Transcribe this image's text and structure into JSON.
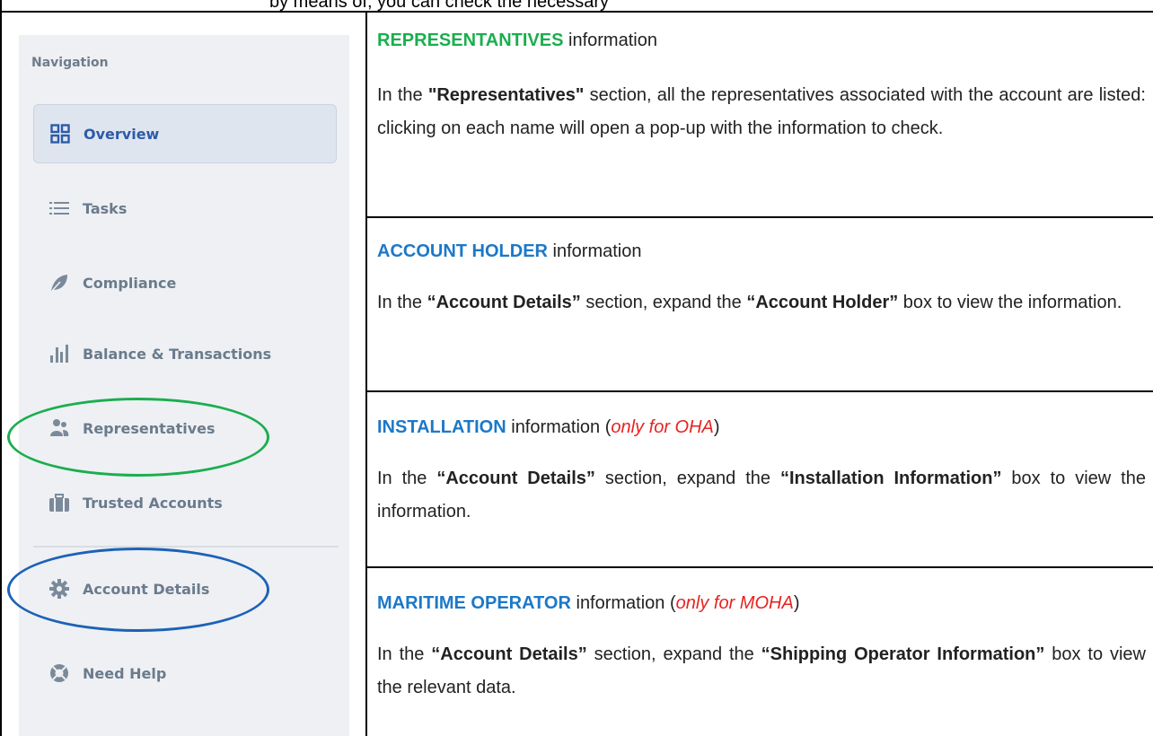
{
  "top_clip_text": "by means of, you can check the necessary",
  "sidebar": {
    "heading": "Navigation",
    "items": [
      {
        "label": "Overview",
        "icon": "grid-icon"
      },
      {
        "label": "Tasks",
        "icon": "list-icon"
      },
      {
        "label": "Compliance",
        "icon": "leaf-icon"
      },
      {
        "label": "Balance & Transactions",
        "icon": "bar-chart-icon"
      },
      {
        "label": "Representatives",
        "icon": "users-icon"
      },
      {
        "label": "Trusted Accounts",
        "icon": "briefcase-icon"
      },
      {
        "label": "Account Details",
        "icon": "gear-icon"
      },
      {
        "label": "Need Help",
        "icon": "lifebuoy-icon"
      }
    ]
  },
  "sections": [
    {
      "keyword": "REPRESENTANTIVES",
      "title_rest": " information",
      "body_pre": "In the ",
      "body_b1": "\"Representatives\"",
      "body_mid": " section, all the representatives associated with the account are listed: clicking on each name will open a pop-up with the information to check."
    },
    {
      "keyword": "ACCOUNT HOLDER",
      "title_rest": " information",
      "body_pre": "In the ",
      "body_b1": "“Account Details”",
      "body_mid": " section, expand the ",
      "body_b2": "“Account Holder”",
      "body_end": " box to view the information."
    },
    {
      "keyword": "INSTALLATION",
      "title_rest": " information (",
      "qualifier": "only for OHA",
      "title_close": ")",
      "body_pre": "In the ",
      "body_b1": "“Account Details”",
      "body_mid": " section, expand the ",
      "body_b2": "“Installation Information”",
      "body_end": " box to view the information."
    },
    {
      "keyword": "MARITIME OPERATOR",
      "title_rest": " information (",
      "qualifier": "only for MOHA",
      "title_close": ")",
      "body_pre": "In the ",
      "body_b1": "“Account Details”",
      "body_mid": " section, expand the ",
      "body_b2": "“Shipping Operator Information”",
      "body_end": " box to view the relevant data."
    }
  ]
}
